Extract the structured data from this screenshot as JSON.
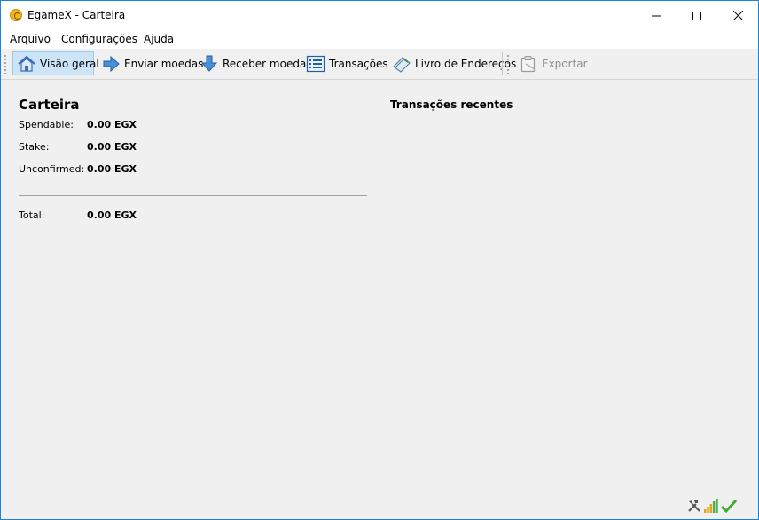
{
  "window": {
    "title": "EgameX - Carteira",
    "accent_border": "#1883d7"
  },
  "menu": [
    {
      "label": "Arquivo"
    },
    {
      "label": "Configurações"
    },
    {
      "label": "Ajuda"
    }
  ],
  "toolbar": {
    "overview": "Visão geral",
    "send": "Enviar moedas",
    "receive": "Receber moedas",
    "transactions": "Transações",
    "addressbook": "Livro de Endereços",
    "export": "Exportar"
  },
  "wallet": {
    "title": "Carteira",
    "spendable_label": "Spendable:",
    "spendable_value": "0.00 EGX",
    "stake_label": "Stake:",
    "stake_value": "0.00 EGX",
    "unconfirmed_label": "Unconfirmed:",
    "unconfirmed_value": "0.00 EGX",
    "total_label": "Total:",
    "total_value": "0.00 EGX"
  },
  "recent": {
    "title": "Transações recentes"
  },
  "status": {
    "icons": [
      "tools-icon",
      "signal-bars-icon",
      "synced-check-icon"
    ]
  }
}
